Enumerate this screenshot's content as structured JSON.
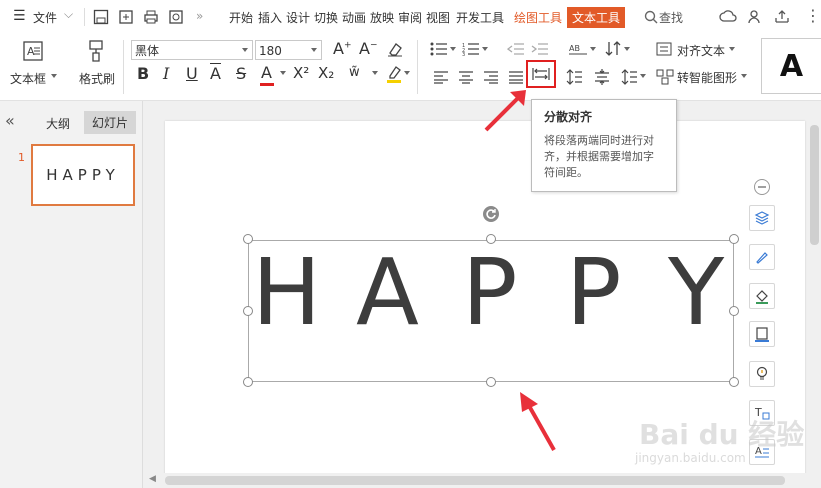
{
  "menu": {
    "file_label": "文件",
    "tabs": [
      "开始",
      "插入",
      "设计",
      "切换",
      "动画",
      "放映",
      "审阅",
      "视图",
      "开发工具",
      "绘图工具",
      "文本工具"
    ],
    "search_label": "查找"
  },
  "ribbon": {
    "textbox_label": "文本框",
    "format_painter_label": "格式刷",
    "font_name": "黑体",
    "font_size": "180",
    "align_text_label": "对齐文本",
    "smartart_label": "转智能图形",
    "text_style_preview": "A",
    "fmt": {
      "bold": "B",
      "italic": "I",
      "underline": "U",
      "strike": "S",
      "fontcolor": "A",
      "superscript": "X²",
      "subscript": "X₂"
    }
  },
  "colors": {
    "accent": "#e25a28",
    "highlight_box": "#e02020",
    "arrow": "#e8303a",
    "font_color_bar": "#e02020",
    "highlight_bar": "#f5d000"
  },
  "panel": {
    "collapse_label": "«",
    "tab_outline": "大纲",
    "tab_slides": "幻灯片",
    "slide_number": "1",
    "thumb_text": "HAPPY"
  },
  "slide": {
    "letters": [
      "H",
      "A",
      "P",
      "P",
      "Y"
    ]
  },
  "tooltip": {
    "title": "分散对齐",
    "body": "将段落两端同时进行对齐，并根据需要增加字符间距。"
  },
  "watermark": {
    "brand": "Bai du 经验",
    "url": "jingyan.baidu.com"
  }
}
